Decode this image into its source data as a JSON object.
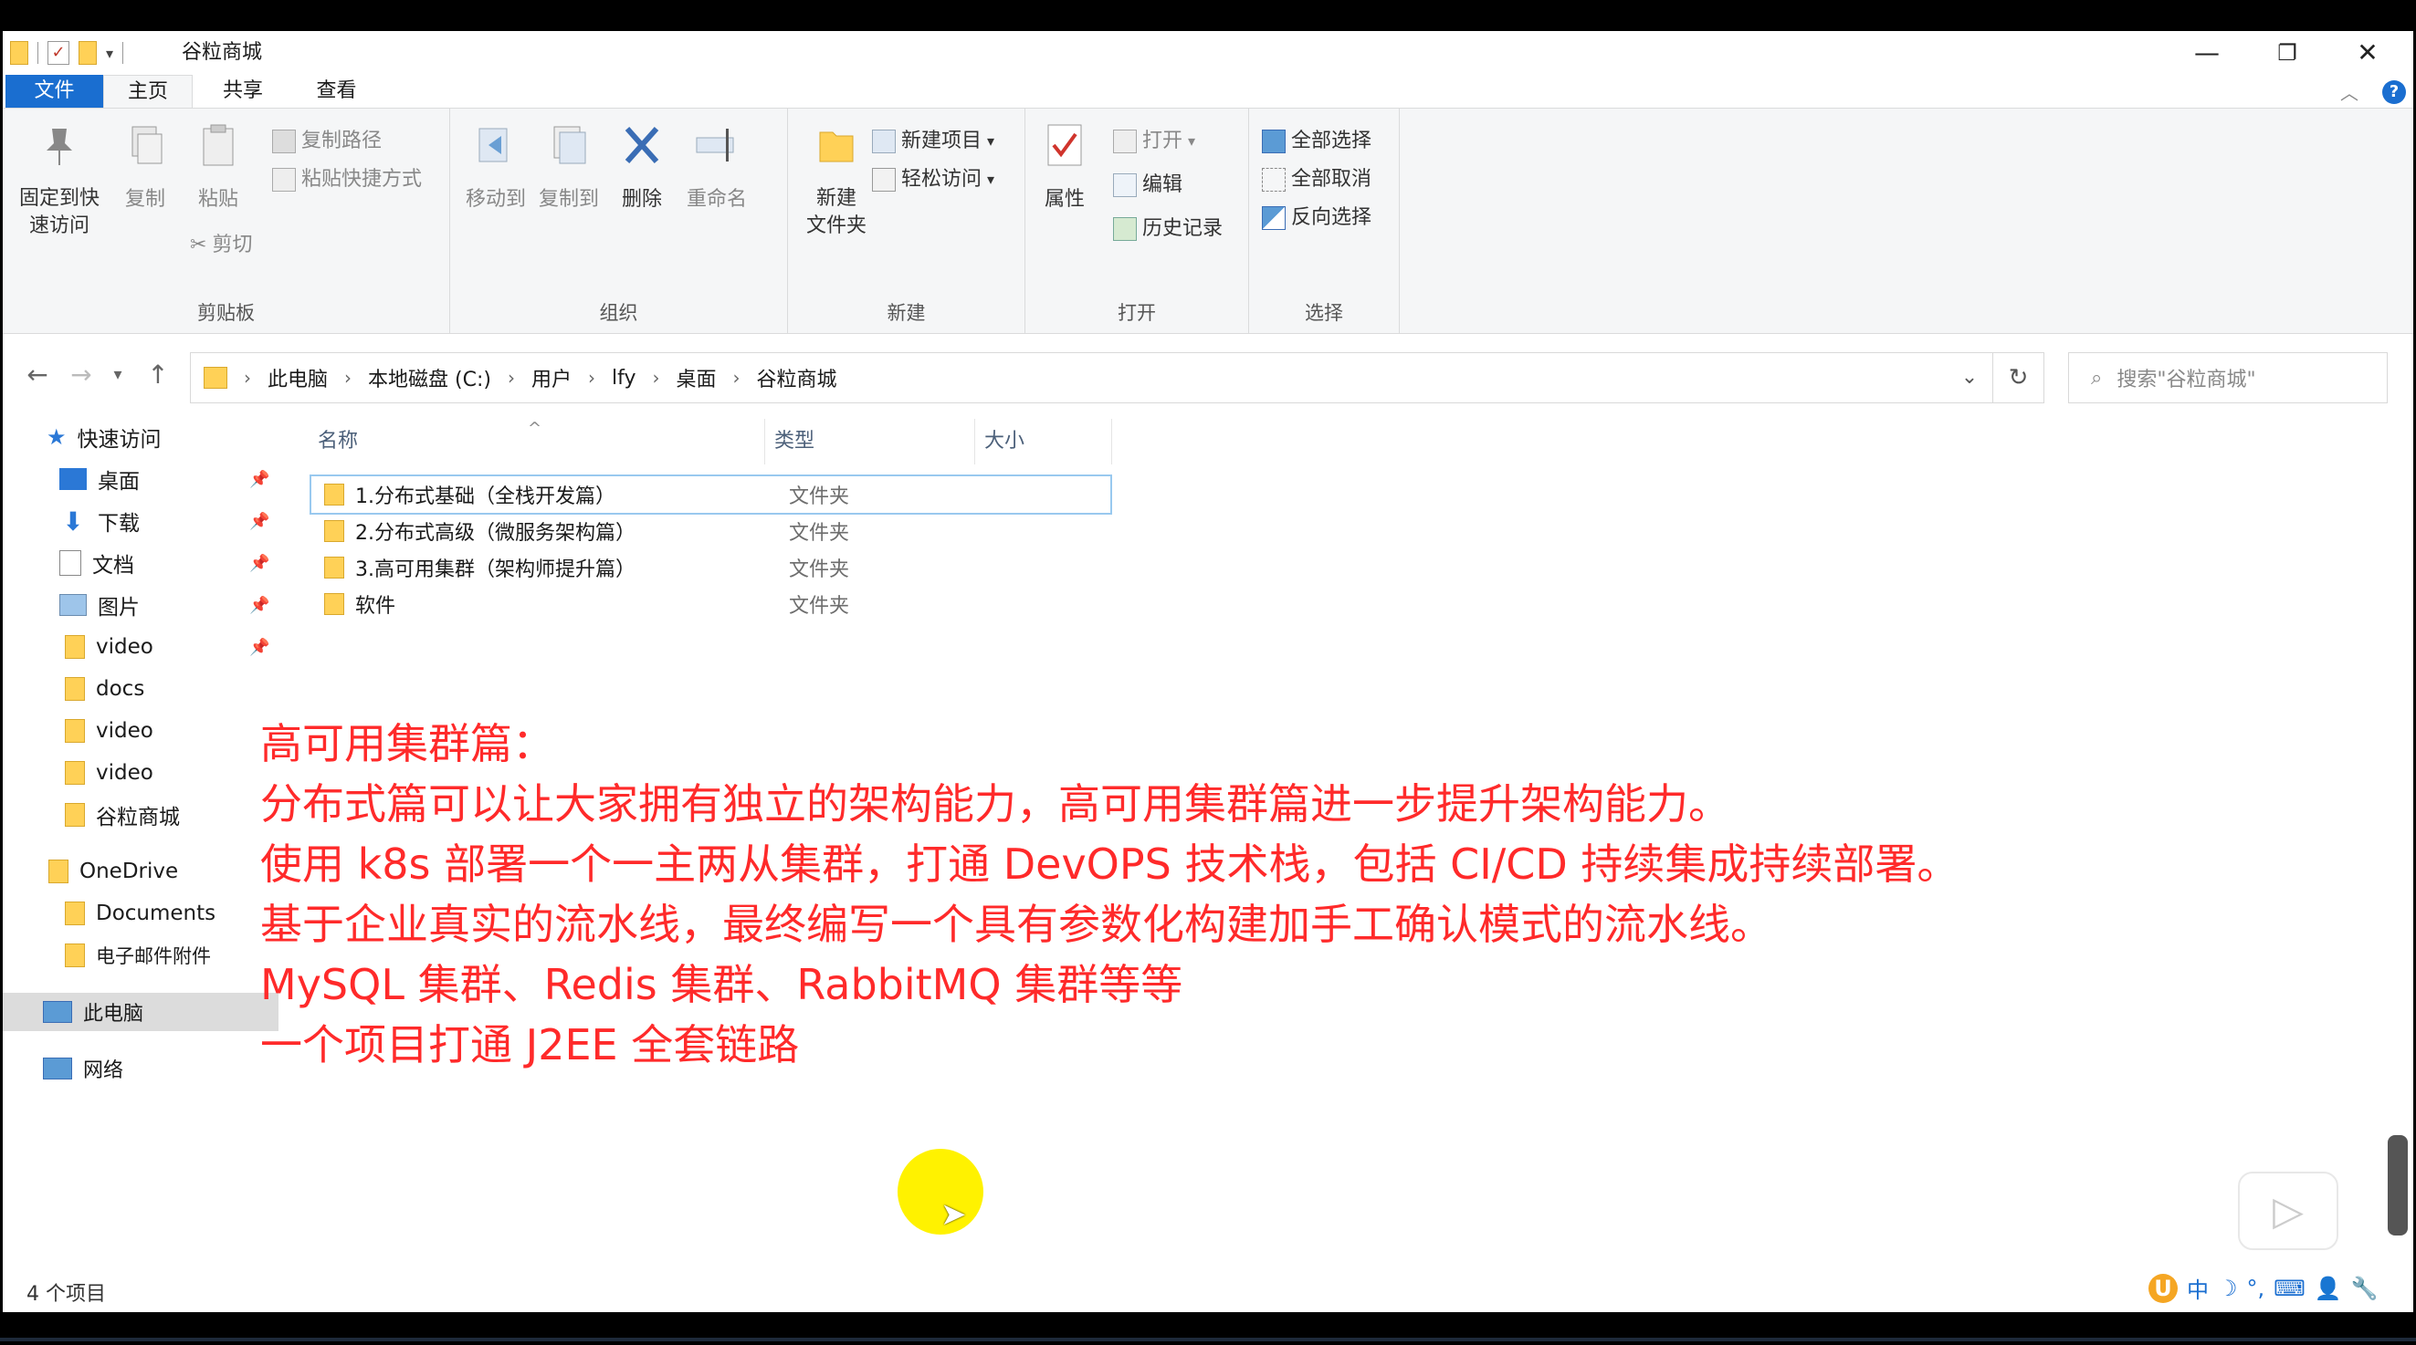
{
  "window": {
    "title": "谷粒商城",
    "controls": {
      "minimize": "—",
      "restore": "❐",
      "close": "✕"
    }
  },
  "ribbon_tabs": {
    "file": "文件",
    "home": "主页",
    "share": "共享",
    "view": "查看",
    "collapse": "︿",
    "help": "?"
  },
  "ribbon": {
    "clipboard": {
      "label": "剪贴板",
      "pin": "固定到快\n速访问",
      "copy": "复制",
      "paste": "粘贴",
      "copy_path": "复制路径",
      "paste_shortcut": "粘贴快捷方式",
      "cut": "剪切"
    },
    "organize": {
      "label": "组织",
      "move_to": "移动到",
      "copy_to": "复制到",
      "delete": "删除",
      "rename": "重命名"
    },
    "new": {
      "label": "新建",
      "new_folder": "新建\n文件夹",
      "new_item": "新建项目",
      "easy_access": "轻松访问"
    },
    "open": {
      "label": "打开",
      "properties": "属性",
      "open": "打开",
      "edit": "编辑",
      "history": "历史记录"
    },
    "select": {
      "label": "选择",
      "select_all": "全部选择",
      "select_none": "全部取消",
      "invert": "反向选择"
    }
  },
  "address": {
    "crumbs": [
      "此电脑",
      "本地磁盘 (C:)",
      "用户",
      "lfy",
      "桌面",
      "谷粒商城"
    ],
    "search_placeholder": "搜索\"谷粒商城\""
  },
  "nav_pane": {
    "quick_access": "快速访问",
    "items": [
      "桌面",
      "下载",
      "文档",
      "图片",
      "video",
      "docs",
      "video",
      "video",
      "谷粒商城"
    ],
    "onedrive": "OneDrive",
    "onedrive_items": [
      "Documents",
      "电子邮件附件"
    ],
    "this_pc": "此电脑",
    "network": "网络"
  },
  "file_list": {
    "columns": {
      "name": "名称",
      "type": "类型",
      "size": "大小"
    },
    "rows": [
      {
        "name": "1.分布式基础（全栈开发篇）",
        "type": "文件夹"
      },
      {
        "name": "2.分布式高级（微服务架构篇）",
        "type": "文件夹"
      },
      {
        "name": "3.高可用集群（架构师提升篇）",
        "type": "文件夹"
      },
      {
        "name": "软件",
        "type": "文件夹"
      }
    ]
  },
  "overlay_text": [
    "高可用集群篇：",
    "分布式篇可以让大家拥有独立的架构能力，高可用集群篇进一步提升架构能力。",
    "使用 k8s 部署一个一主两从集群，打通 DevOPS 技术栈，包括 CI/CD 持续集成持续部署。",
    "基于企业真实的流水线，最终编写一个具有参数化构建加手工确认模式的流水线。",
    "MySQL 集群、Redis 集群、RabbitMQ 集群等等",
    "一个项目打通 J2EE 全套链路"
  ],
  "status": {
    "item_count": "4 个项目"
  },
  "tray": {
    "ime": "中",
    "icons": [
      "moon-icon",
      "punct-icon",
      "keyboard-icon",
      "user-icon",
      "wrench-icon"
    ]
  },
  "colors": {
    "accent": "#1a6ed0",
    "overlay_red": "#ff2a2a",
    "folder": "#ffd157"
  }
}
